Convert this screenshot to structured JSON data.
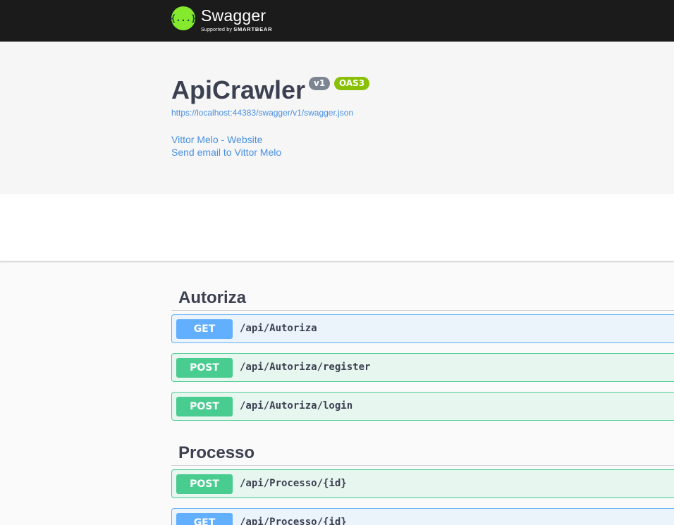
{
  "header": {
    "brand": "Swagger",
    "logo_glyph": "{...}",
    "supported_by": "Supported by",
    "smartbear": "SMARTBEAR"
  },
  "info": {
    "title": "ApiCrawler",
    "version_badge": "v1",
    "oas_badge": "OAS3",
    "spec_url": "https://localhost:44383/swagger/v1/swagger.json",
    "contact_website": "Vittor Melo - Website",
    "contact_email": "Send email to Vittor Melo"
  },
  "colors": {
    "get": "#61affe",
    "post": "#49cc90",
    "link": "#4990e2",
    "topbar": "#1b1b1b",
    "logo": "#85ea2d"
  },
  "tags": [
    {
      "name": "Autoriza",
      "operations": [
        {
          "method": "GET",
          "path": "/api/Autoriza"
        },
        {
          "method": "POST",
          "path": "/api/Autoriza/register"
        },
        {
          "method": "POST",
          "path": "/api/Autoriza/login"
        }
      ]
    },
    {
      "name": "Processo",
      "operations": [
        {
          "method": "POST",
          "path": "/api/Processo/{id}"
        },
        {
          "method": "GET",
          "path": "/api/Processo/{id}"
        }
      ]
    }
  ]
}
